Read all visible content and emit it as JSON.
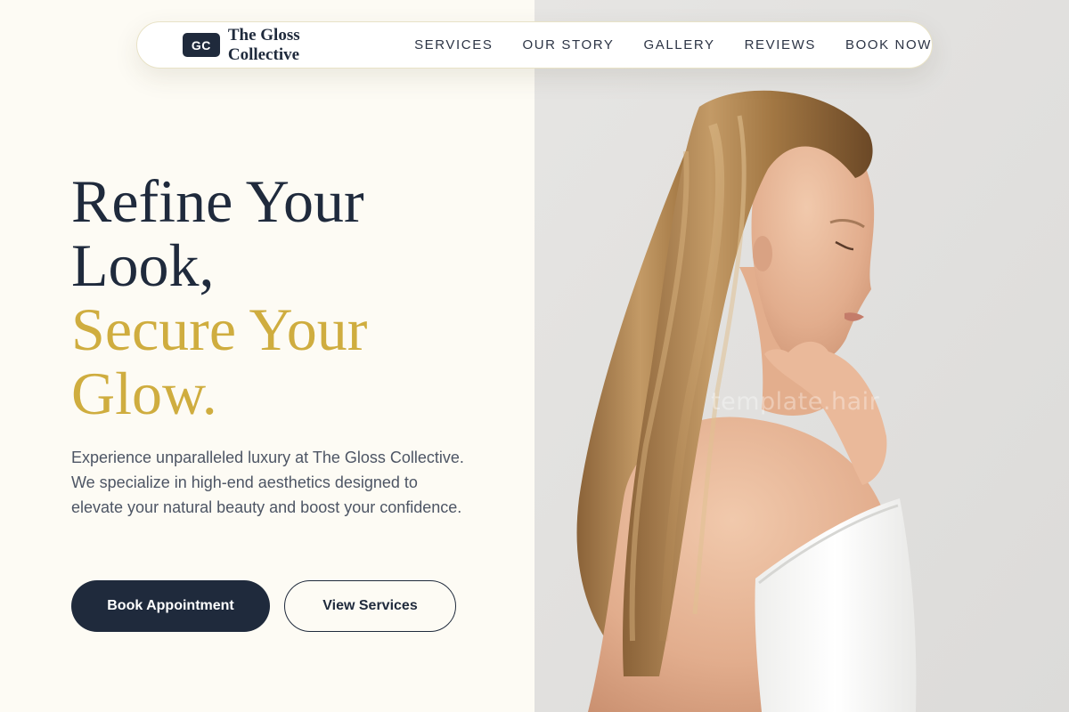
{
  "brand": {
    "logo": "GC",
    "name": "The Gloss Collective"
  },
  "nav": {
    "links": [
      "SERVICES",
      "OUR STORY",
      "GALLERY",
      "REVIEWS",
      "BOOK NOW"
    ]
  },
  "hero": {
    "title_lines": [
      "Refine Your",
      "Look,"
    ],
    "title_accent_lines": [
      "Secure Your",
      "Glow."
    ],
    "description": "Experience unparalleled luxury at The Gloss Collective. We specialize in high-end aesthetics designed to elevate your natural beauty and boost your confidence.",
    "primary_button": "Book Appointment",
    "secondary_button": "View Services"
  },
  "image": {
    "watermark": "template.hair"
  },
  "colors": {
    "navy": "#1f2a3c",
    "gold": "#cfad3f",
    "cream": "#fdfbf4",
    "photo_background": "#e4e3e1"
  }
}
